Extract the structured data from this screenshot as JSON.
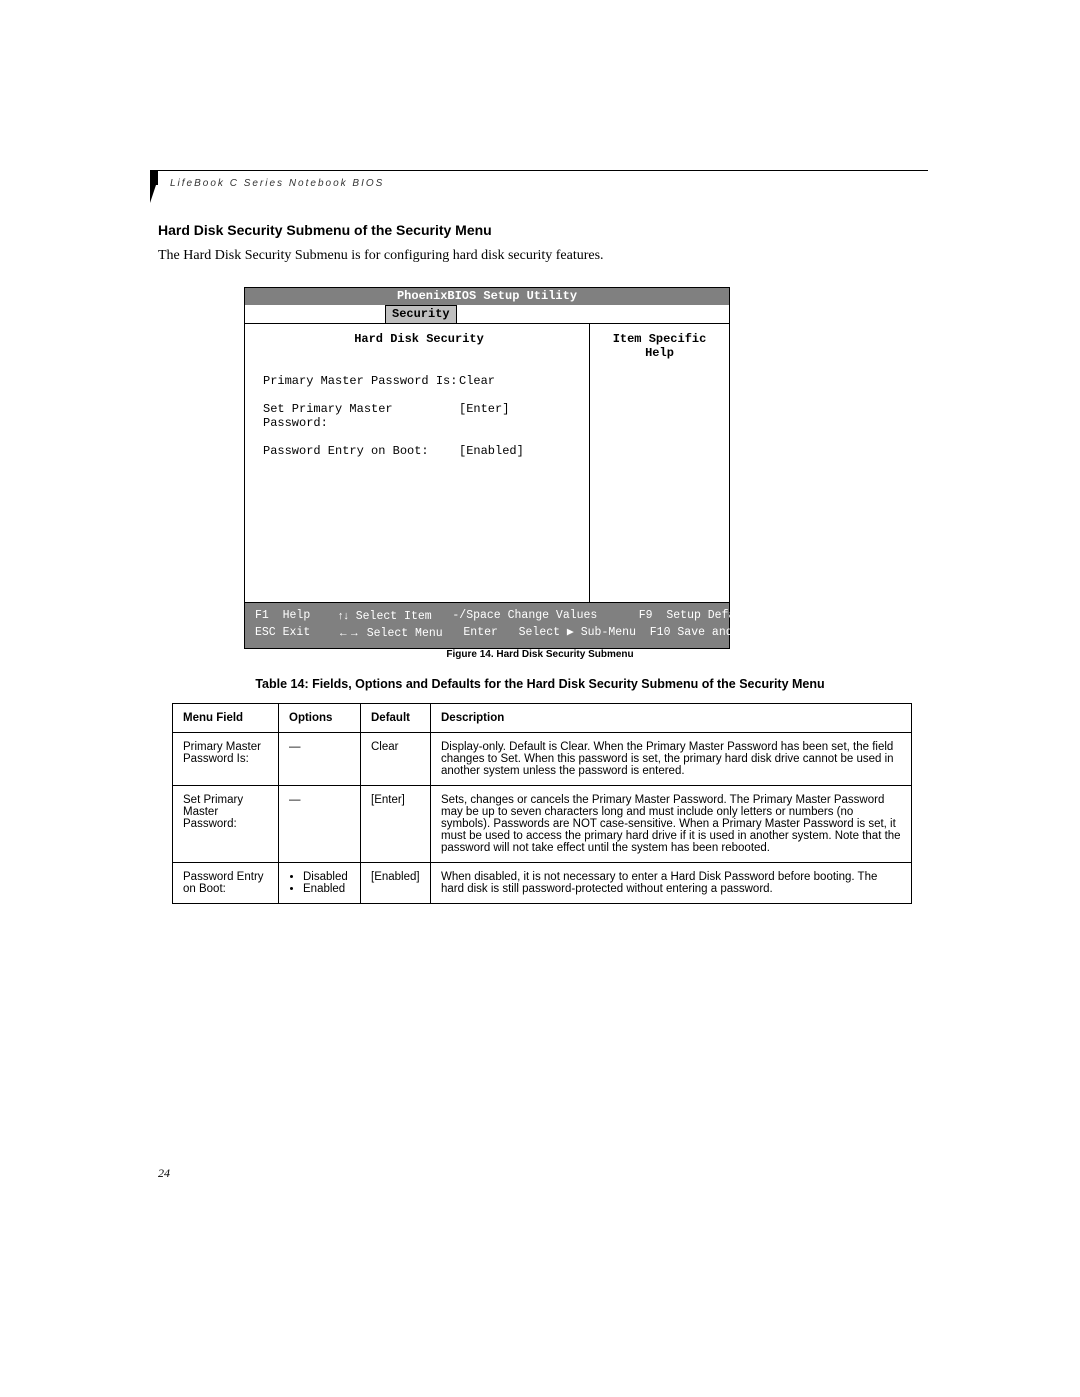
{
  "running_header": "LifeBook C Series Notebook BIOS",
  "section_title": "Hard Disk Security Submenu of the Security Menu",
  "intro_text": "The Hard Disk Security Submenu is for configuring hard disk security features.",
  "bios": {
    "utility_title": "PhoenixBIOS Setup Utility",
    "active_tab": "Security",
    "left_heading": "Hard Disk Security",
    "right_heading": "Item Specific Help",
    "rows": [
      {
        "label": "Primary Master Password Is:",
        "value": "Clear"
      },
      {
        "label": "Set Primary Master Password:",
        "value": "[Enter]"
      },
      {
        "label": "Password Entry on Boot:",
        "value": "[Enabled]"
      }
    ],
    "footer": {
      "line1": {
        "k1": "F1",
        "a1": "Help",
        "k2": "↑↓",
        "a2": "Select Item",
        "k3": "-/Space",
        "a3": "Change Values",
        "k4": "F9",
        "a4": "Setup Defaults"
      },
      "line2": {
        "k1": "ESC",
        "a1": "Exit",
        "k2": "←→",
        "a2": "Select Menu",
        "k3": "Enter",
        "a3": "Select ▶ Sub-Menu",
        "k4": "F10",
        "a4": "Save and Exit"
      }
    }
  },
  "figure_caption": "Figure 14.  Hard Disk Security Submenu",
  "table_title": "Table 14: Fields, Options and Defaults for the Hard Disk Security Submenu of the Security Menu",
  "table": {
    "headers": {
      "menu": "Menu Field",
      "options": "Options",
      "default_": "Default",
      "description": "Description"
    },
    "rows": [
      {
        "menu": "Primary Master Password Is:",
        "options_text": "—",
        "default_": "Clear",
        "description": "Display-only. Default is Clear. When the Primary Master Password has been set, the field changes to Set. When this password is set, the primary hard disk drive cannot be used in another system unless the password is entered."
      },
      {
        "menu": "Set Primary Master Password:",
        "options_text": "—",
        "default_": "[Enter]",
        "description": "Sets, changes or cancels the Primary Master Password. The Primary Master Password may be up to seven characters long and must include only letters or numbers (no symbols). Passwords are NOT case-sensitive. When a Primary Master Password is set, it must be used to access the primary hard drive if it is used in another system. Note that the password will not take effect until the system has been rebooted."
      },
      {
        "menu": "Password Entry on Boot:",
        "options_list": [
          "Disabled",
          "Enabled"
        ],
        "default_": "[Enabled]",
        "description": "When disabled, it is not necessary to enter a Hard Disk Password before booting. The hard disk is still password-protected without entering a password."
      }
    ]
  },
  "page_number": "24"
}
